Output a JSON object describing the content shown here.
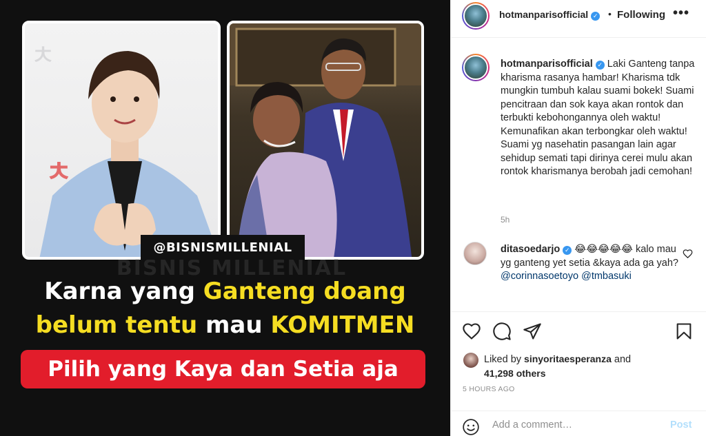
{
  "post_image": {
    "watermark_handle": "@BISNISMILLENIAL",
    "bg_watermark": "BISNIS MILLENIAL",
    "headline_line1_pre": "Karna yang ",
    "headline_line1_highlight": "Ganteng doang",
    "headline_line2_highlight": "belum tentu",
    "headline_line2_mid": " mau ",
    "headline_line2_highlight2": "KOMITMEN",
    "banner_text": "Pilih yang Kaya dan Setia aja",
    "colors": {
      "highlight": "#f5dd22",
      "banner": "#e21d2b",
      "background": "#101010"
    }
  },
  "header": {
    "username": "hotmanparisofficial",
    "verified_icon": "verified-badge-icon",
    "separator": "•",
    "follow_status": "Following",
    "more_icon": "more-options-icon"
  },
  "caption": {
    "username": "hotmanparisofficial",
    "text": "Laki Ganteng tanpa kharisma rasanya hambar! Kharisma tdk mungkin tumbuh kalau suami bokek! Suami pencitraan dan sok kaya akan rontok dan terbukti kebohongannya oleh waktu! Kemunafikan akan terbongkar oleh waktu! Suami yg nasehatin pasangan lain agar sehidup semati tapi dirinya cerei mulu akan rontok kharismanya berobah jadi cemohan!",
    "time": "5h"
  },
  "comment": {
    "username": "ditasoedarjo",
    "emojis": "😂😂😂😂😂",
    "text": " kalo mau yg ganteng yet setia &kaya ada ga yah? ",
    "mention1": "@corinnasoetoyo",
    "mention2": "@tmbasuki"
  },
  "likes": {
    "prefix": "Liked by ",
    "liker": "sinyoritaesperanza",
    "and": " and",
    "count": "41,298 others"
  },
  "post_time": "5 HOURS AGO",
  "add_comment": {
    "placeholder": "Add a comment…",
    "post_label": "Post"
  },
  "icons": [
    "heart-icon",
    "comment-bubble-icon",
    "share-paper-plane-icon",
    "bookmark-icon",
    "emoji-smiley-icon"
  ]
}
